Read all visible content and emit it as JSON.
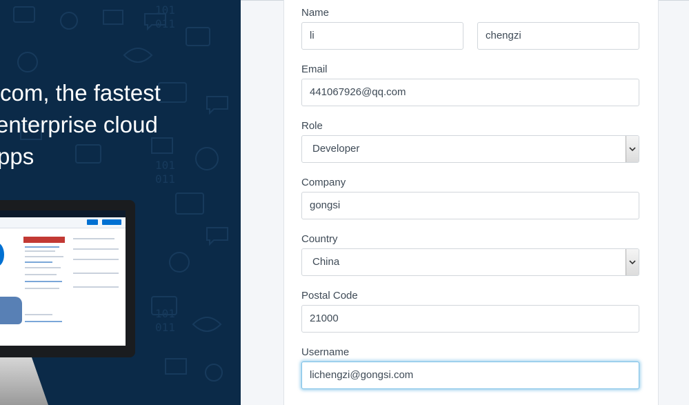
{
  "hero": {
    "headline_lines": [
      "com, the fastest",
      "enterprise cloud",
      "pps"
    ]
  },
  "form": {
    "name": {
      "label": "Name",
      "first_value": "li",
      "last_value": "chengzi"
    },
    "email": {
      "label": "Email",
      "value": "441067926@qq.com"
    },
    "role": {
      "label": "Role",
      "selected": "Developer"
    },
    "company": {
      "label": "Company",
      "value": "gongsi"
    },
    "country": {
      "label": "Country",
      "selected": "China"
    },
    "postal_code": {
      "label": "Postal Code",
      "value": "21000"
    },
    "username": {
      "label": "Username",
      "value": "lichengzi@gongsi.com"
    }
  },
  "colors": {
    "hero_bg": "#0b2a48",
    "focus_glow": "#7cc0e6",
    "label_text": "#3e4a56"
  }
}
